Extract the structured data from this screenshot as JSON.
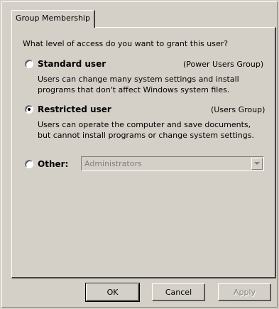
{
  "tab": {
    "label": "Group Membership"
  },
  "prompt": "What level of access do you want to grant this user?",
  "options": [
    {
      "label": "Standard user",
      "group": "(Power Users Group)",
      "description_line1": "Users can change many system settings and install",
      "description_line2": "programs that don't affect Windows system files.",
      "checked": false
    },
    {
      "label": "Restricted user",
      "group": "(Users Group)",
      "description_line1": "Users can operate the computer and save documents,",
      "description_line2": "but cannot install programs or change system settings.",
      "checked": true
    }
  ],
  "other": {
    "label": "Other:",
    "selected_value": "Administrators",
    "checked": false,
    "enabled": false
  },
  "buttons": {
    "ok": "OK",
    "cancel": "Cancel",
    "apply": "Apply"
  },
  "colors": {
    "face": "#d4d0c8",
    "disabled_text": "#808080"
  }
}
